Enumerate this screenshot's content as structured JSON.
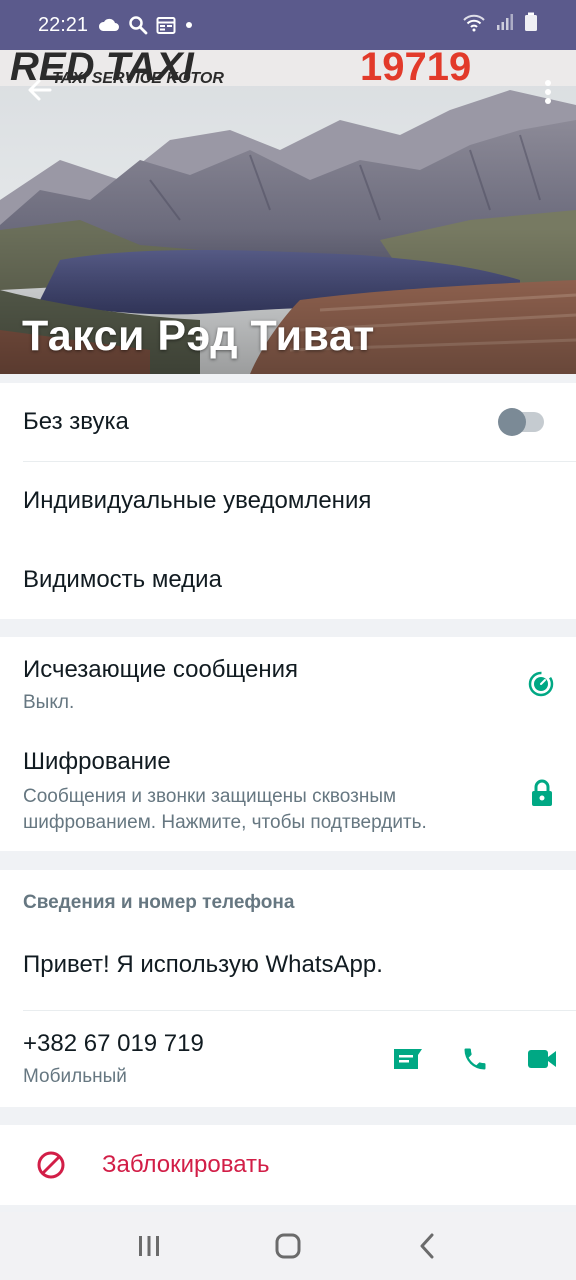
{
  "status_bar": {
    "time": "22:21",
    "icons_left": [
      "cloud-icon",
      "search-icon",
      "calendar-icon",
      "dot-icon"
    ],
    "icons_right": [
      "wifi-icon",
      "signal-icon",
      "battery-icon"
    ]
  },
  "header": {
    "contact_name": "Такси Рэд Тиват",
    "photo_brand_text": "RED TAXI 19719",
    "photo_subtitle": "TAXI SERVICE KOTOR"
  },
  "settings": {
    "mute_label": "Без звука",
    "mute_enabled": false,
    "custom_notifications_label": "Индивидуальные уведомления",
    "media_visibility_label": "Видимость медиа"
  },
  "privacy": {
    "disappearing_title": "Исчезающие сообщения",
    "disappearing_value": "Выкл.",
    "encryption_title": "Шифрование",
    "encryption_desc": "Сообщения и звонки защищены сквозным шифрованием. Нажмите, чтобы подтвердить."
  },
  "about": {
    "section_label": "Сведения и номер телефона",
    "status_text": "Привет! Я использую WhatsApp.",
    "phone": "+382 67 019 719",
    "phone_type": "Мобильный"
  },
  "block": {
    "label": "Заблокировать"
  },
  "colors": {
    "status_bar": "#5b5a8c",
    "accent_green": "#00a884",
    "block_red": "#d21e47",
    "secondary_text": "#667781"
  }
}
